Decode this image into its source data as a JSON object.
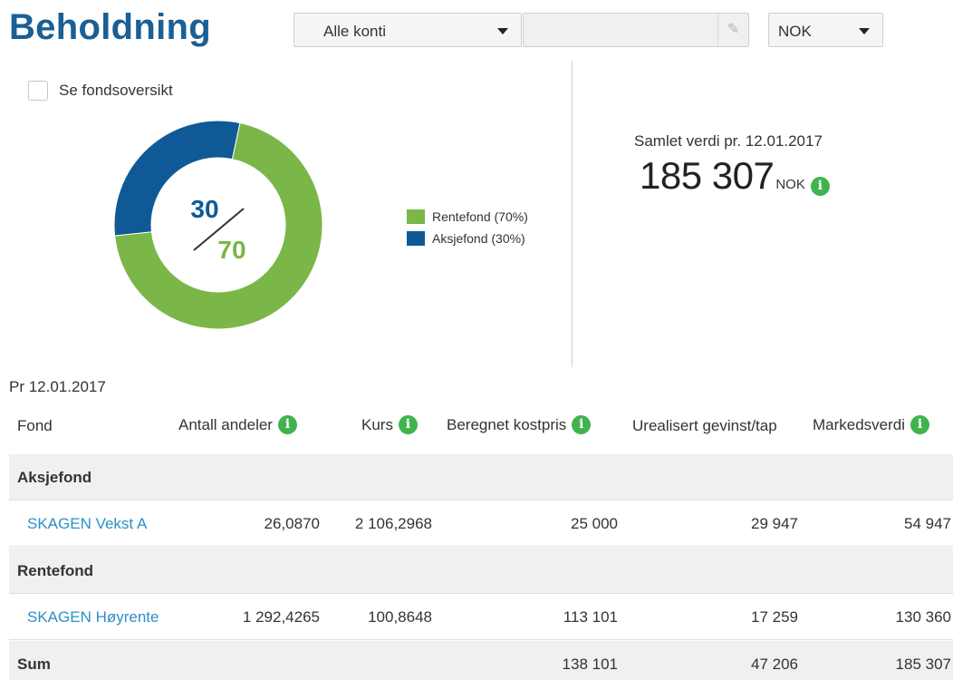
{
  "page": {
    "title": "Beholdning",
    "account_select": "Alle konti",
    "account_name_placeholder": "",
    "currency_select": "NOK",
    "fund_overview_label": "Se fondsoversikt"
  },
  "chart_data": {
    "type": "pie",
    "slices": [
      {
        "name": "Rentefond (70%)",
        "value": 70,
        "color": "#7ab648"
      },
      {
        "name": "Aksjefond (30%)",
        "value": 30,
        "color": "#0f5a96"
      }
    ],
    "center_top": "30",
    "center_bottom": "70",
    "legend_position": "right"
  },
  "summary": {
    "label": "Samlet verdi pr. 12.01.2017",
    "value": "185 307",
    "currency": "NOK"
  },
  "table": {
    "as_of": "Pr 12.01.2017",
    "headers": {
      "fund": "Fond",
      "units": "Antall andeler",
      "price": "Kurs",
      "cost": "Beregnet kostpris",
      "gain": "Urealisert gevinst/tap",
      "market": "Markedsverdi"
    },
    "groups": [
      {
        "name": "Aksjefond",
        "funds": [
          {
            "name": "SKAGEN Vekst A",
            "units": "26,0870",
            "price": "2 106,2968",
            "cost": "25 000",
            "gain": "29 947",
            "market": "54 947"
          }
        ]
      },
      {
        "name": "Rentefond",
        "funds": [
          {
            "name": "SKAGEN Høyrente",
            "units": "1 292,4265",
            "price": "100,8648",
            "cost": "113 101",
            "gain": "17 259",
            "market": "130 360"
          }
        ]
      }
    ],
    "sum": {
      "label": "Sum",
      "cost": "138 101",
      "gain": "47 206",
      "market": "185 307"
    }
  },
  "colors": {
    "brand": "#1a5f95",
    "link": "#2c8fc9",
    "info": "#40b34f"
  }
}
